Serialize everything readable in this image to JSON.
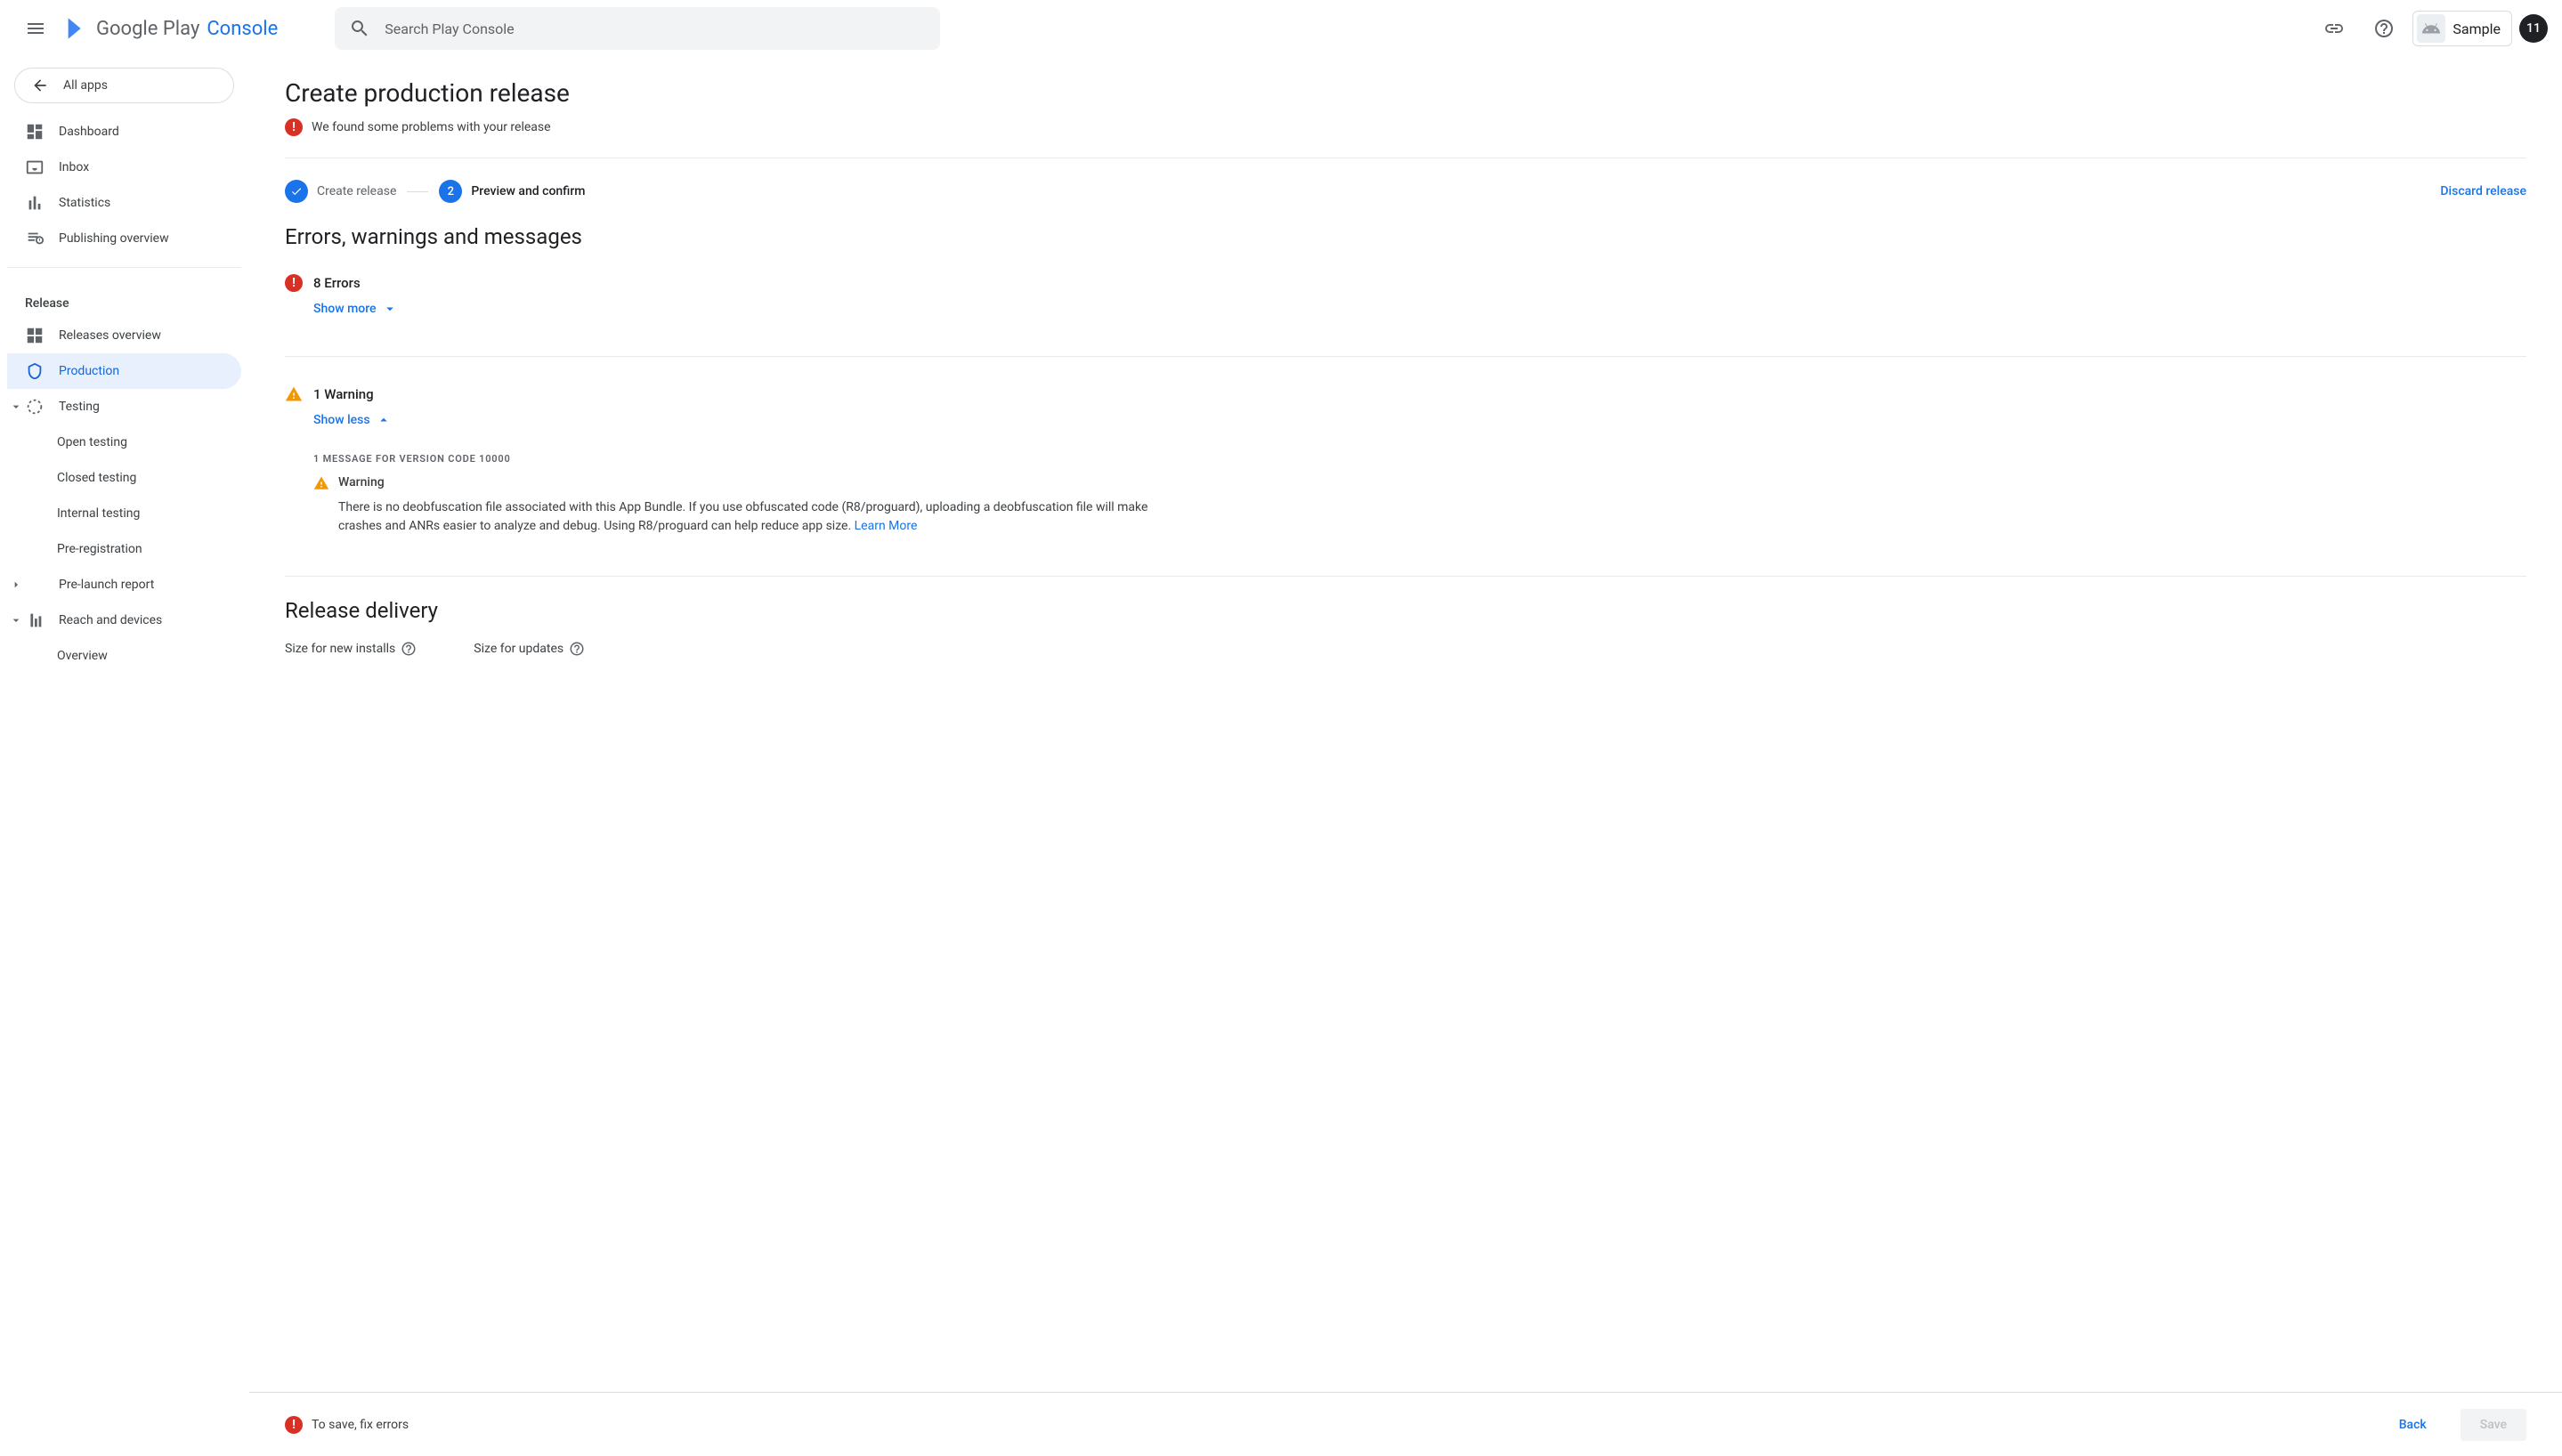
{
  "appbar": {
    "brand_play": "Google Play",
    "brand_console": "Console",
    "search_placeholder": "Search Play Console",
    "sample_label": "Sample",
    "avatar_initials": "11"
  },
  "sidebar": {
    "back_label": "All apps",
    "top_items": [
      {
        "label": "Dashboard"
      },
      {
        "label": "Inbox"
      },
      {
        "label": "Statistics"
      },
      {
        "label": "Publishing overview"
      }
    ],
    "release_section": "Release",
    "release_items": [
      {
        "label": "Releases overview"
      },
      {
        "label": "Production",
        "active": true
      },
      {
        "label": "Testing",
        "expandable": true,
        "expanded": true
      },
      {
        "label": "Open testing",
        "child": true
      },
      {
        "label": "Closed testing",
        "child": true
      },
      {
        "label": "Internal testing",
        "child": true
      },
      {
        "label": "Pre-registration",
        "child": true
      },
      {
        "label": "Pre-launch report",
        "expandable": true,
        "expanded": false
      },
      {
        "label": "Reach and devices",
        "expandable": true,
        "expanded": true
      },
      {
        "label": "Overview",
        "child": true
      }
    ]
  },
  "page": {
    "title": "Create production release",
    "problem_banner": "We found some problems with your release",
    "stepper": {
      "step1": "Create release",
      "step2_num": "2",
      "step2": "Preview and confirm"
    },
    "discard": "Discard release",
    "section_msgs": "Errors, warnings and messages",
    "errors": {
      "count_label": "8 Errors",
      "toggle": "Show more"
    },
    "warnings": {
      "count_label": "1 Warning",
      "toggle": "Show less",
      "subheader": "1 MESSAGE FOR VERSION CODE 10000",
      "item_title": "Warning",
      "item_body": "There is no deobfuscation file associated with this App Bundle. If you use obfuscated code (R8/proguard), uploading a deobfuscation file will make crashes and ANRs easier to analyze and debug. Using R8/proguard can help reduce app size. ",
      "item_link": "Learn More"
    },
    "section_delivery": "Release delivery",
    "delivery": {
      "new_installs": "Size for new installs",
      "updates": "Size for updates"
    }
  },
  "footer": {
    "message": "To save, fix errors",
    "back": "Back",
    "save": "Save"
  }
}
